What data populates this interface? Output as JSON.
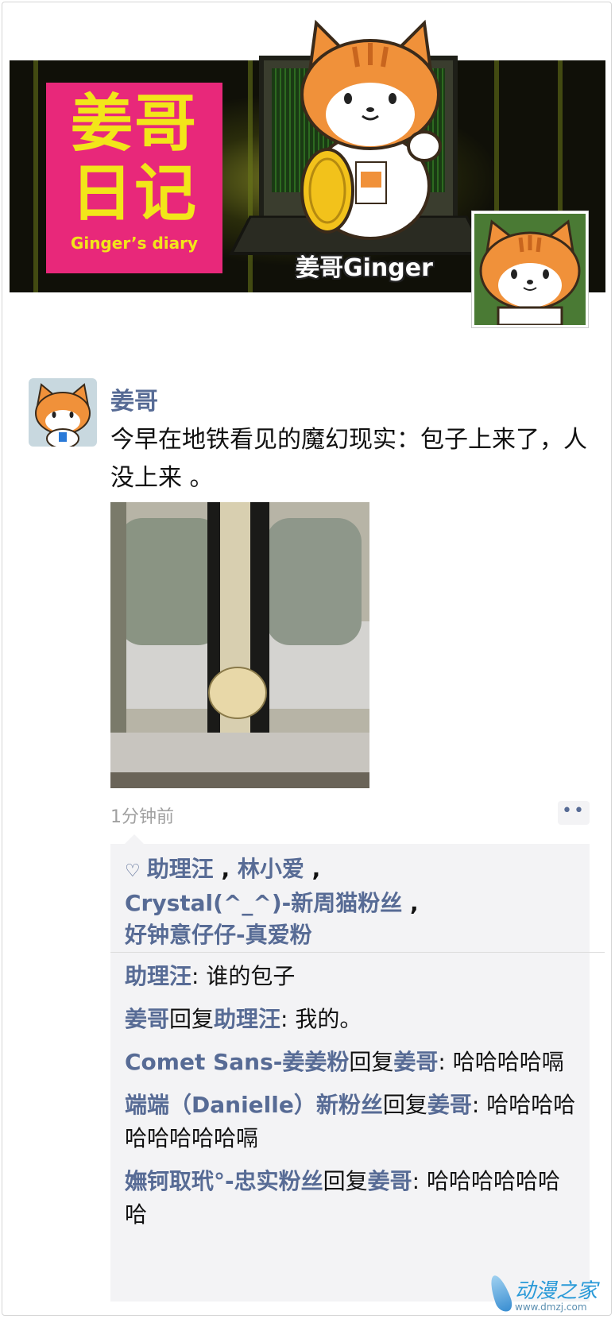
{
  "banner": {
    "logo_line1": "姜哥",
    "logo_line2": "日记",
    "logo_english": "Ginger’s diary",
    "label": "姜哥Ginger"
  },
  "post": {
    "author": "姜哥",
    "text": "今早在地铁看见的魔幻现实：包子上来了，人没上来 。",
    "time": "1分钟前",
    "more_label": "••"
  },
  "likes": {
    "users": [
      "助理汪",
      "林小爱",
      "Crystal(^_^)-新周猫粉丝",
      "好钟意仔仔-真爱粉"
    ]
  },
  "comments": [
    {
      "user": "助理汪",
      "reply_to": "",
      "text": "谁的包子"
    },
    {
      "user": "姜哥",
      "reply_to": "助理汪",
      "text": "我的。"
    },
    {
      "user": "Comet Sans-姜姜粉",
      "reply_to": "姜哥",
      "text": "哈哈哈哈嗝"
    },
    {
      "user": "端端（Danielle）新粉丝",
      "reply_to": "姜哥",
      "text": "哈哈哈哈哈哈哈哈哈嗝"
    },
    {
      "user": "嫵钶取玳°-忠实粉丝",
      "reply_to": "姜哥",
      "text": "哈哈哈哈哈哈哈"
    }
  ],
  "labels": {
    "reply": "回复",
    "colon": ": ",
    "comma": " , "
  },
  "watermark": {
    "name": "动漫之家",
    "url": "www.dmzj.com"
  },
  "colors": {
    "link": "#576b95",
    "logo_bg": "#e8287a",
    "logo_text": "#f2e619"
  }
}
